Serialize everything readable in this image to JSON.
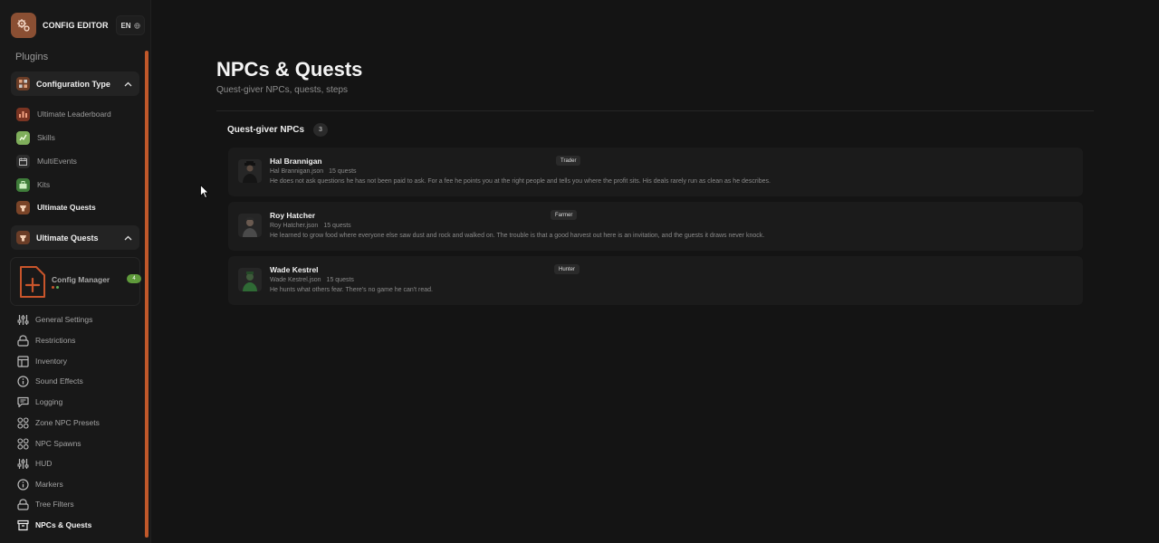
{
  "app": {
    "title": "CONFIG EDITOR",
    "language": "EN",
    "accent": "#c0582a"
  },
  "sidebar": {
    "plugins_label": "Plugins",
    "config_type_group": {
      "label": "Configuration Type",
      "expanded": true
    },
    "plugins": [
      {
        "label": "Ultimate Leaderboard",
        "icon": "leaderboard-icon",
        "color": "#7a3422"
      },
      {
        "label": "Skills",
        "icon": "skills-icon",
        "color": "#7fae5b"
      },
      {
        "label": "MultiEvents",
        "icon": "calendar-icon",
        "color": "#2c2c2c"
      },
      {
        "label": "Kits",
        "icon": "kits-icon",
        "color": "#3f7d3a"
      },
      {
        "label": "Ultimate Quests",
        "icon": "quests-icon",
        "color": "#7a4428",
        "active": true
      }
    ],
    "quests_group": {
      "label": "Ultimate Quests",
      "expanded": true
    },
    "config_manager": {
      "label": "Config Manager",
      "badge": "4"
    },
    "nav": [
      {
        "label": "General Settings",
        "icon": "sliders-icon"
      },
      {
        "label": "Restrictions",
        "icon": "lock-icon"
      },
      {
        "label": "Inventory",
        "icon": "layout-icon"
      },
      {
        "label": "Sound Effects",
        "icon": "info-icon"
      },
      {
        "label": "Logging",
        "icon": "message-icon"
      },
      {
        "label": "Zone NPC Presets",
        "icon": "grid-icon"
      },
      {
        "label": "NPC Spawns",
        "icon": "grid-icon"
      },
      {
        "label": "HUD",
        "icon": "sliders-icon"
      },
      {
        "label": "Markers",
        "icon": "info-icon"
      },
      {
        "label": "Tree Filters",
        "icon": "lock-icon"
      },
      {
        "label": "NPCs & Quests",
        "icon": "archive-icon",
        "active": true
      }
    ]
  },
  "main": {
    "title": "NPCs & Quests",
    "subtitle": "Quest-giver NPCs, quests, steps",
    "section": {
      "title": "Quest-giver NPCs",
      "count": "3"
    },
    "npcs": [
      {
        "name": "Hal Brannigan",
        "tag": "Trader",
        "file": "Hal Brannigan.json",
        "quests": "15 quests",
        "description": "He does not ask questions he has not been paid to ask. For a fee he points you at the right people and tells you where the profit sits. His deals rarely run as clean as he describes."
      },
      {
        "name": "Roy Hatcher",
        "tag": "Farmer",
        "file": "Roy Hatcher.json",
        "quests": "15 quests",
        "description": "He learned to grow food where everyone else saw dust and rock and walked on. The trouble is that a good harvest out here is an invitation, and the guests it draws never knock."
      },
      {
        "name": "Wade Kestrel",
        "tag": "Hunter",
        "file": "Wade Kestrel.json",
        "quests": "15 quests",
        "description": "He hunts what others fear. There's no game he can't read."
      }
    ]
  }
}
